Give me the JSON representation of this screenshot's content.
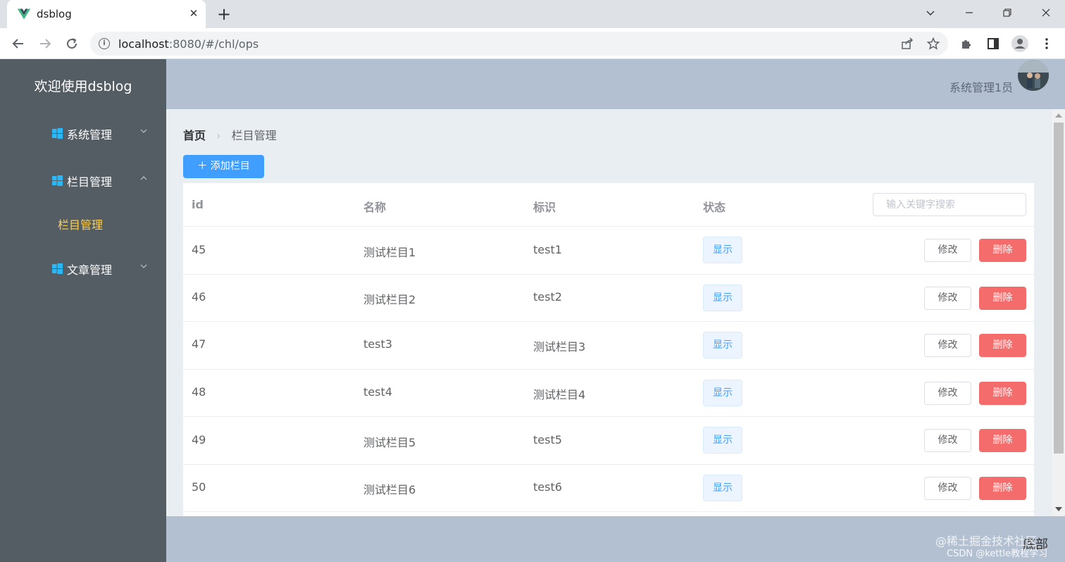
{
  "browser": {
    "tab_title": "dsblog",
    "url_host": "localhost",
    "url_rest": ":8080/#/chl/ops"
  },
  "app": {
    "brand": "欢迎使用dsblog",
    "user": "系统管理1员",
    "footer": "底部",
    "menu": [
      {
        "label": "系统管理",
        "icon": "windows-icon",
        "expanded": false
      },
      {
        "label": "栏目管理",
        "icon": "windows-icon",
        "expanded": true
      },
      {
        "label": "文章管理",
        "icon": "windows-icon",
        "expanded": false
      }
    ],
    "submenu_active": "栏目管理",
    "accent": "#409eff",
    "danger": "#f56c6c",
    "active_submenu_color": "#ffd04b"
  },
  "breadcrumb": {
    "home": "首页",
    "current": "栏目管理"
  },
  "toolbar": {
    "add_label": "添加栏目"
  },
  "table": {
    "headers": [
      "id",
      "名称",
      "标识",
      "状态"
    ],
    "search_placeholder": "输入关键字搜索",
    "rows": [
      {
        "id": "45",
        "name": "测试栏目1",
        "mark": "test1",
        "status": "显示",
        "edit": "修改",
        "del": "删除"
      },
      {
        "id": "46",
        "name": "测试栏目2",
        "mark": "test2",
        "status": "显示",
        "edit": "修改",
        "del": "删除"
      },
      {
        "id": "47",
        "name": "test3",
        "mark": "测试栏目3",
        "status": "显示",
        "edit": "修改",
        "del": "删除"
      },
      {
        "id": "48",
        "name": "test4",
        "mark": "测试栏目4",
        "status": "显示",
        "edit": "修改",
        "del": "删除"
      },
      {
        "id": "49",
        "name": "测试栏目5",
        "mark": "test5",
        "status": "显示",
        "edit": "修改",
        "del": "删除"
      },
      {
        "id": "50",
        "name": "测试栏目6",
        "mark": "test6",
        "status": "显示",
        "edit": "修改",
        "del": "删除"
      }
    ]
  },
  "watermark": {
    "line1": "@稀土掘金技术社区",
    "line2": "CSDN @kettle教程学习"
  }
}
